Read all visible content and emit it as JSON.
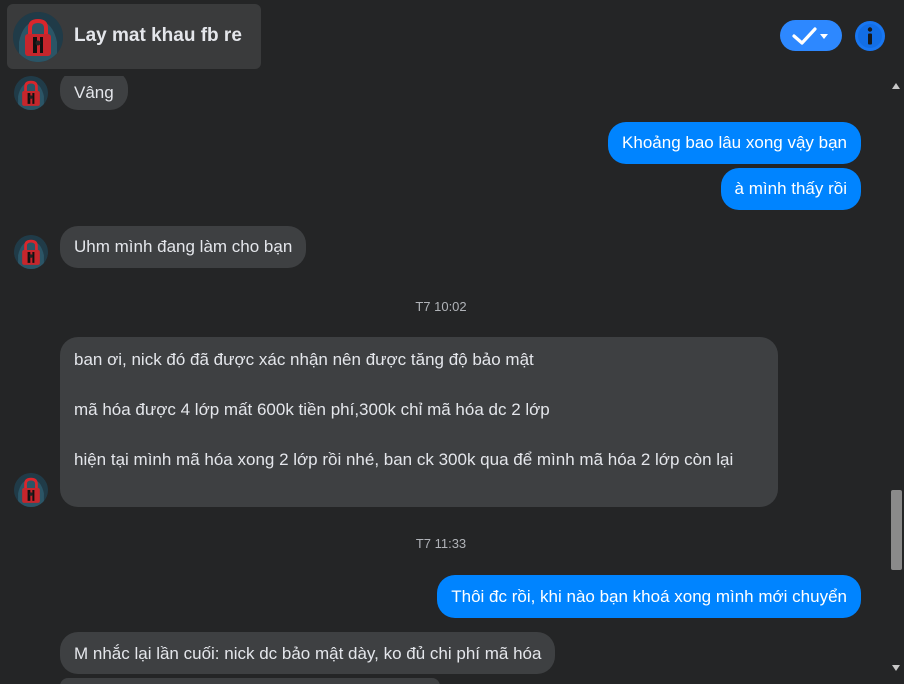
{
  "header": {
    "title": "Lay mat khau fb re",
    "check_icon": "check-dropdown-icon",
    "info_icon": "info-icon",
    "accent": "#2d88ff"
  },
  "messages": [
    {
      "side": "in",
      "text": "Vâng"
    },
    {
      "side": "out",
      "text": "Khoảng bao lâu xong vậy bạn"
    },
    {
      "side": "out",
      "text": "à mình thấy rồi"
    },
    {
      "side": "in",
      "text": "Uhm mình đang làm cho bạn"
    },
    {
      "timestamp": "T7 10:02"
    },
    {
      "side": "in",
      "lines": [
        "ban ơi, nick đó đã được xác nhận nên được tăng độ bảo mật",
        "mã hóa được 4 lớp mất 600k tiền phí,300k chỉ mã hóa dc 2 lớp",
        "hiện tại mình mã hóa xong 2 lớp rồi nhé, ban ck 300k qua để mình mã hóa 2 lớp còn lại"
      ]
    },
    {
      "timestamp": "T7 11:33"
    },
    {
      "side": "out",
      "text": "Thôi đc rồi, khi nào bạn khoá xong mình mới chuyển"
    },
    {
      "side": "in",
      "text": "M nhắc lại lần cuối: nick dc bảo mật dày, ko đủ chi phí mã hóa"
    }
  ],
  "colors": {
    "background": "#242526",
    "incoming_bubble": "#3e4042",
    "outgoing_bubble": "#0084ff",
    "timestamp_text": "#b0b3b8"
  }
}
